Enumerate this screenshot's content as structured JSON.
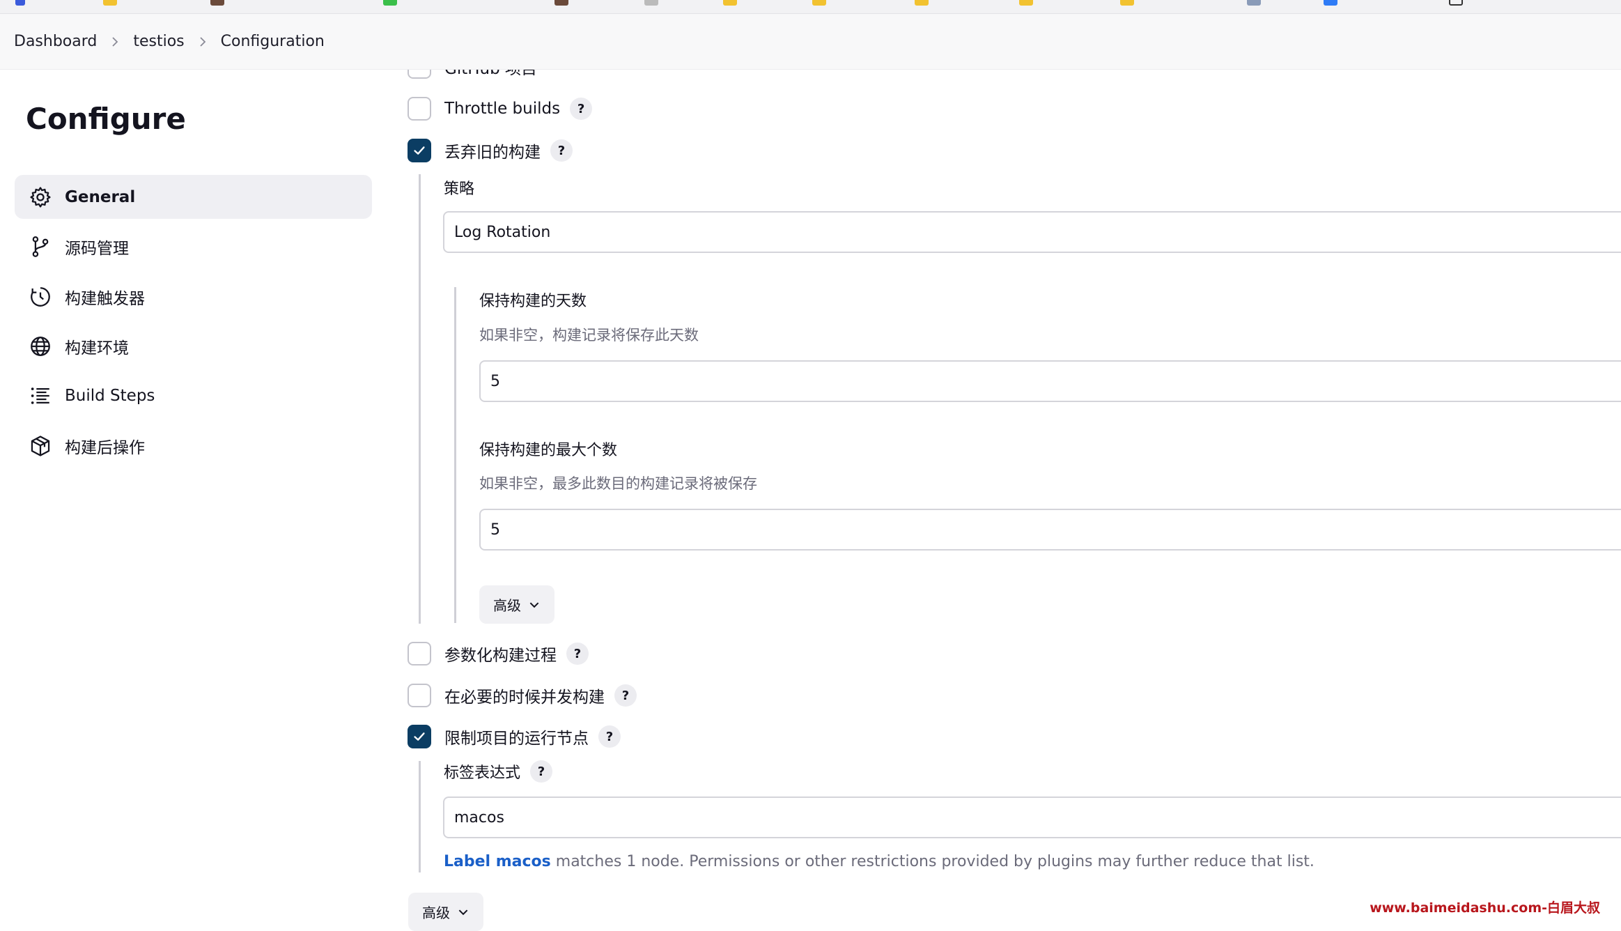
{
  "breadcrumb": {
    "items": [
      "Dashboard",
      "testios",
      "Configuration"
    ]
  },
  "sidebar": {
    "title": "Configure",
    "items": [
      {
        "label": "General",
        "icon": "gear-icon",
        "active": true
      },
      {
        "label": "源码管理",
        "icon": "branch-icon"
      },
      {
        "label": "构建触发器",
        "icon": "clock-icon"
      },
      {
        "label": "构建环境",
        "icon": "globe-icon"
      },
      {
        "label": "Build Steps",
        "icon": "list-icon"
      },
      {
        "label": "构建后操作",
        "icon": "package-icon"
      }
    ]
  },
  "general": {
    "github_project": {
      "label": "GitHub 项目",
      "checked": false
    },
    "throttle_builds": {
      "label": "Throttle builds",
      "checked": false
    },
    "discard_old_builds": {
      "label": "丢弃旧的构建",
      "checked": true,
      "strategy_label": "策略",
      "strategy_value": "Log Rotation",
      "days_to_keep": {
        "label": "保持构建的天数",
        "description": "如果非空，构建记录将保存此天数",
        "value": "5"
      },
      "max_builds": {
        "label": "保持构建的最大个数",
        "description": "如果非空，最多此数目的构建记录将被保存",
        "value": "5"
      },
      "advanced_label": "高级"
    },
    "parameterized": {
      "label": "参数化构建过程",
      "checked": false
    },
    "concurrent": {
      "label": "在必要的时候并发构建",
      "checked": false
    },
    "restrict_node": {
      "label": "限制项目的运行节点",
      "checked": true,
      "label_expression_label": "标签表达式",
      "label_expression_value": "macos",
      "match_link": "Label macos",
      "match_text": " matches 1 node. Permissions or other restrictions provided by plugins may further reduce that list."
    },
    "advanced_label": "高级",
    "help_symbol": "?"
  },
  "watermark": "www.baimeidashu.com-白眉大叔",
  "colors": {
    "checkbox_checked": "#0b3d63",
    "link": "#1a5fc8",
    "watermark": "#b8161c"
  }
}
